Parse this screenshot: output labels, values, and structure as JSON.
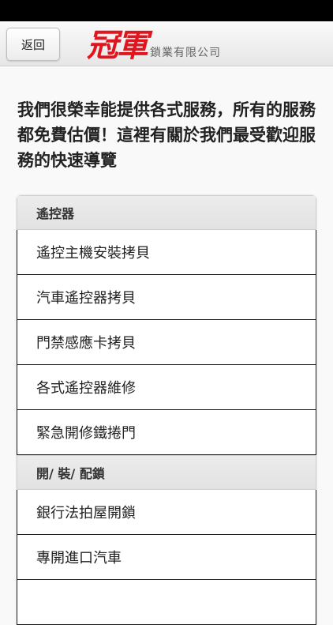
{
  "header": {
    "back_label": "返回",
    "logo_mark": "冠軍",
    "logo_sub": "鎖業有限公司"
  },
  "intro": {
    "text": "我們很榮幸能提供各式服務，所有的服務都免費估價！這裡有關於我們最受歡迎服務的快速導覽"
  },
  "sections": [
    {
      "title": "遙控器",
      "items": [
        "遙控主機安裝拷貝",
        "汽車遙控器拷貝",
        "門禁感應卡拷貝",
        "各式遙控器維修",
        "緊急開修鐵捲門"
      ]
    },
    {
      "title": "開/ 裝/ 配鎖",
      "items": [
        "銀行法拍屋開鎖",
        "專開進口汽車"
      ]
    }
  ]
}
